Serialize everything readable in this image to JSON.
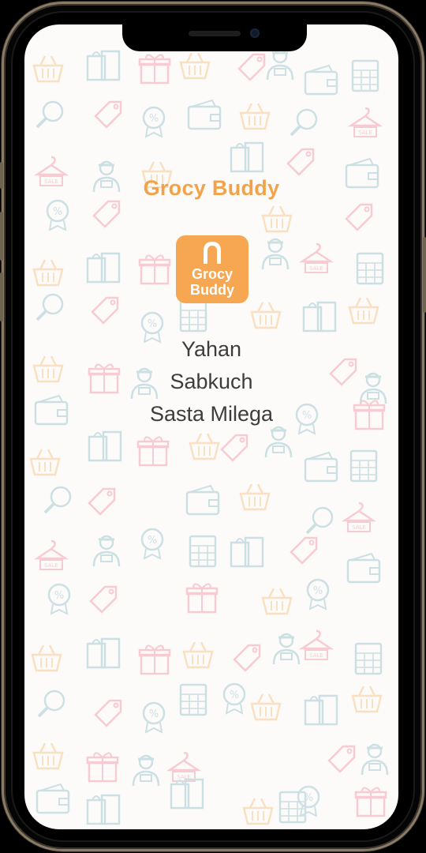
{
  "app": {
    "brand_title": "Grocy Buddy",
    "logo_line1": "Grocy",
    "logo_line2": "Buddy",
    "tagline_line1": "Yahan",
    "tagline_line2": "Sabkuch",
    "tagline_line3": "Sasta Milega"
  },
  "colors": {
    "brand_orange": "#f2a34a",
    "logo_bg": "#f7a752",
    "text_dark": "#3d3d3d",
    "background": "#fdfbfa",
    "phone_frame": "#8a7b66"
  },
  "background_pattern_icons": [
    "shopping-basket-icon",
    "shopping-bag-icon",
    "gift-box-icon",
    "price-tag-icon",
    "search-icon",
    "discount-badge-icon",
    "wallet-icon",
    "calculator-icon",
    "hanger-sale-icon",
    "delivery-person-icon"
  ]
}
